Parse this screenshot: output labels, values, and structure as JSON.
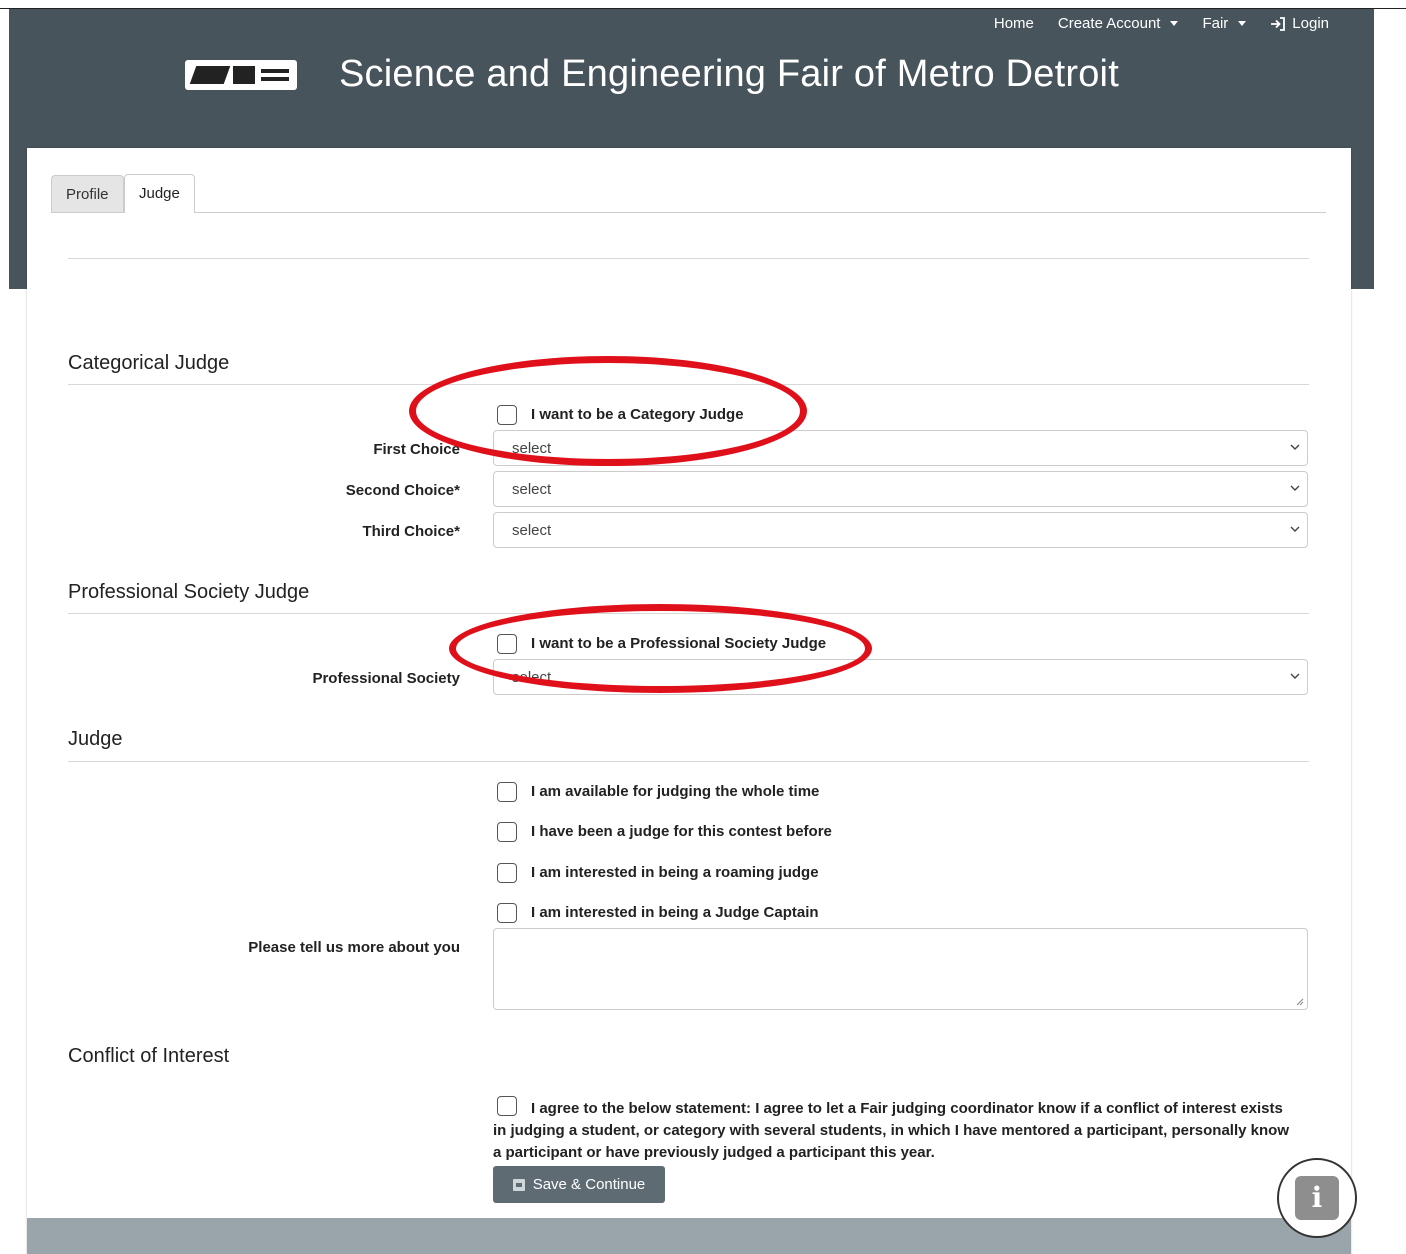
{
  "nav": {
    "home": "Home",
    "create_account": "Create Account",
    "fair": "Fair",
    "login": "Login"
  },
  "site": {
    "title": "Science and Engineering Fair of Metro Detroit"
  },
  "tabs": [
    {
      "label": "Profile",
      "active": false
    },
    {
      "label": "Judge",
      "active": true
    }
  ],
  "categorical": {
    "title": "Categorical Judge",
    "checkbox_label": "I want to be a Category Judge",
    "first_label": "First Choice",
    "first_value": "select",
    "second_label": "Second Choice*",
    "second_value": "select",
    "third_label": "Third Choice*",
    "third_value": "select"
  },
  "professional": {
    "title": "Professional Society Judge",
    "checkbox_label": "I want to be a Professional Society Judge",
    "society_label": "Professional Society",
    "society_value": "select"
  },
  "judge": {
    "title": "Judge",
    "options": [
      "I am available for judging the whole time",
      "I have been a judge for this contest before",
      "I am interested in being a roaming judge",
      "I am interested in being a Judge Captain"
    ],
    "about_label": "Please tell us more about you",
    "about_value": ""
  },
  "conflict": {
    "title": "Conflict of Interest",
    "statement": "I agree to the below statement: I agree to let a Fair judging coordinator know if a conflict of interest exists in judging a student, or category with several students, in which I have mentored a participant, personally know a participant or have previously judged a participant this year."
  },
  "actions": {
    "save_label": "Save & Continue"
  },
  "colors": {
    "header": "#48545c",
    "annotation": "#e0101b",
    "button": "#5e6b73"
  }
}
